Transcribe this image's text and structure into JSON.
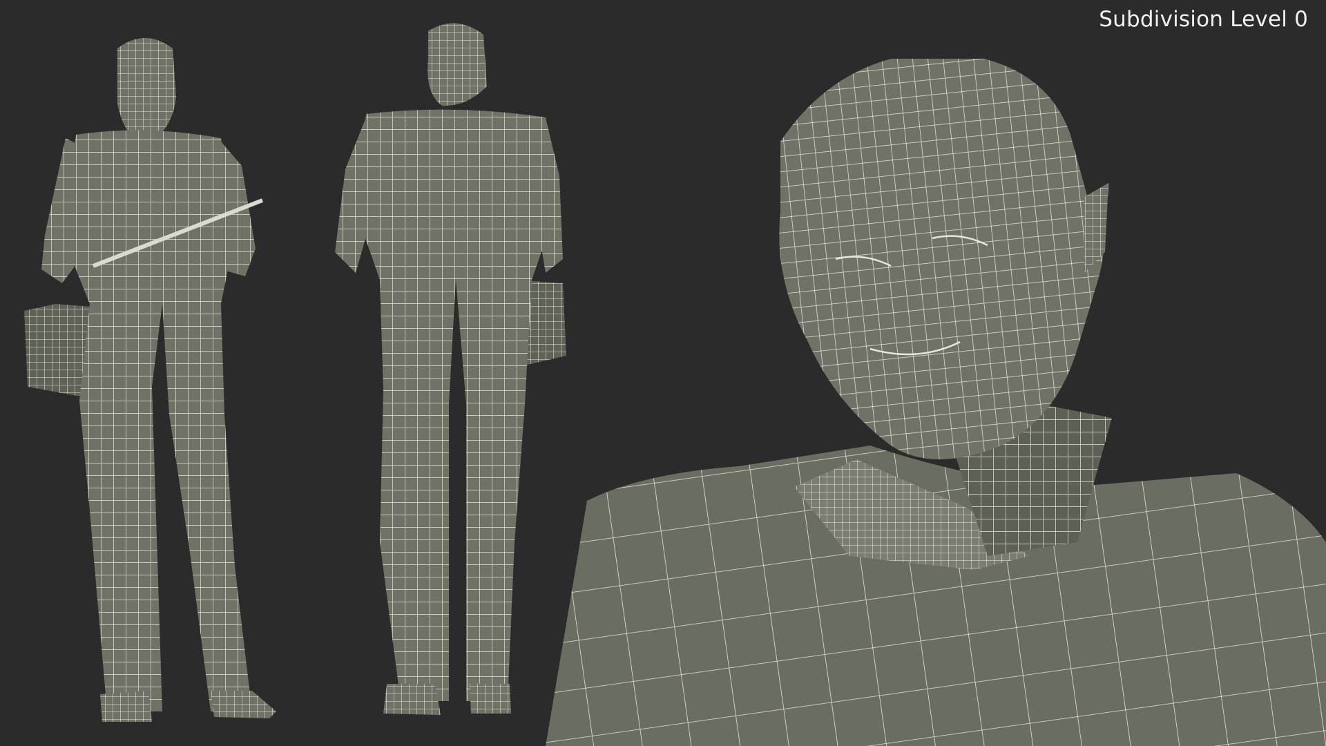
{
  "caption": "Subdivision Level 0",
  "colors": {
    "background": "#2b2b2b",
    "mesh_fill": "#6f7265",
    "mesh_shade": "#5a5d52",
    "wire": "#e8e6da",
    "caption_text": "#f2f2f2"
  },
  "views": [
    "front-full-body",
    "back-full-body",
    "face-closeup"
  ]
}
